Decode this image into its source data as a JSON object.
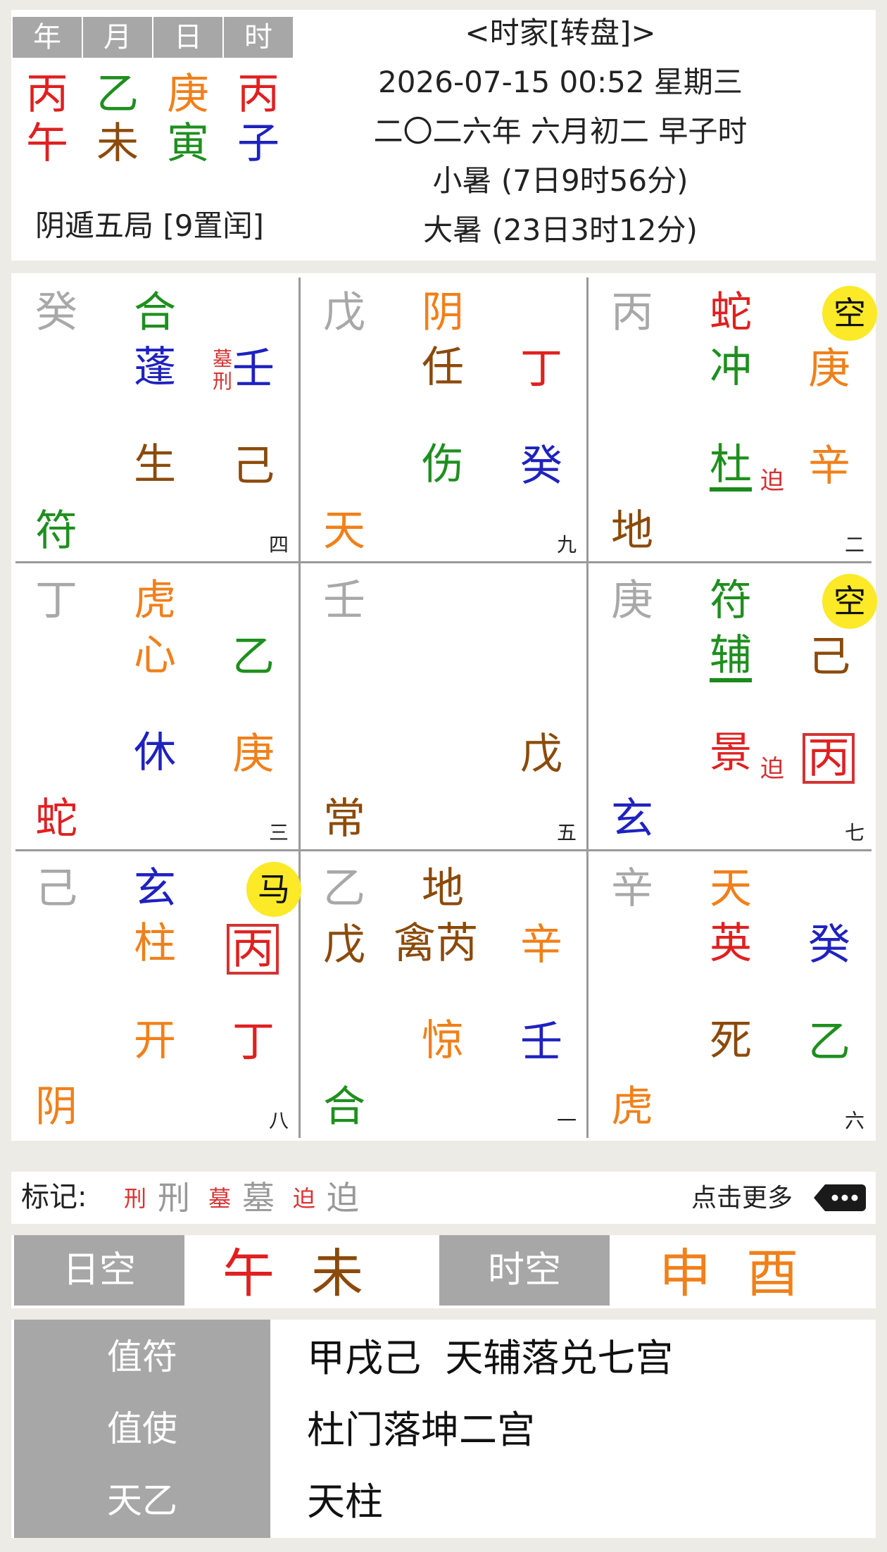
{
  "header": {
    "pillar_labels": [
      "年",
      "月",
      "日",
      "时"
    ],
    "stems": [
      "丙",
      "乙",
      "庚",
      "丙"
    ],
    "branches": [
      "午",
      "未",
      "寅",
      "子"
    ],
    "stem_colors": [
      "#e02020",
      "#1e8f1e",
      "#f0801a",
      "#e02020"
    ],
    "branch_colors": [
      "#e02020",
      "#8b4a0a",
      "#1e8f1e",
      "#1e22c0"
    ],
    "ju": "阴遁五局 [9置闰]",
    "title": "<时家[转盘]>",
    "datetime": "2026-07-15 00:52 星期三",
    "lunar": "二〇二六年 六月初二 早子时",
    "term1": "小暑 (7日9时56分)",
    "term2": "大暑 (23日3时12分)"
  },
  "palaces": [
    {
      "earth": "癸",
      "god": {
        "t": "合",
        "c": "#1e8f1e"
      },
      "star": {
        "t": "蓬",
        "c": "#1e22c0"
      },
      "ts": {
        "t": "壬",
        "c": "#1e22c0"
      },
      "door": {
        "t": "生",
        "c": "#8b4a0a"
      },
      "ds": {
        "t": "己",
        "c": "#8b4a0a"
      },
      "corner": {
        "t": "符",
        "c": "#1e8f1e"
      },
      "num": "四",
      "marks": [
        "墓",
        "刑"
      ]
    },
    {
      "earth": "戊",
      "god": {
        "t": "阴",
        "c": "#f0801a"
      },
      "star": {
        "t": "任",
        "c": "#8b4a0a"
      },
      "ts": {
        "t": "丁",
        "c": "#e02020"
      },
      "door": {
        "t": "伤",
        "c": "#1e8f1e"
      },
      "ds": {
        "t": "癸",
        "c": "#1e22c0"
      },
      "corner": {
        "t": "天",
        "c": "#f0801a"
      },
      "num": "九"
    },
    {
      "earth": "丙",
      "god": {
        "t": "蛇",
        "c": "#e02020"
      },
      "star": {
        "t": "冲",
        "c": "#1e8f1e"
      },
      "ts": {
        "t": "庚",
        "c": "#f0801a"
      },
      "door": {
        "t": "杜",
        "c": "#1e8f1e"
      },
      "ds": {
        "t": "辛",
        "c": "#f0801a"
      },
      "corner": {
        "t": "地",
        "c": "#8b4a0a"
      },
      "num": "二",
      "kong": "空",
      "door_mark": "迫"
    },
    {
      "earth": "丁",
      "god": {
        "t": "虎",
        "c": "#f0801a"
      },
      "star": {
        "t": "心",
        "c": "#f0801a"
      },
      "ts": {
        "t": "乙",
        "c": "#1e8f1e"
      },
      "door": {
        "t": "休",
        "c": "#1e22c0"
      },
      "ds": {
        "t": "庚",
        "c": "#f0801a"
      },
      "corner": {
        "t": "蛇",
        "c": "#e02020"
      },
      "num": "三"
    },
    {
      "earth": "壬",
      "ds": {
        "t": "戊",
        "c": "#8b4a0a"
      },
      "corner": {
        "t": "常",
        "c": "#8b4a0a"
      },
      "num": "五"
    },
    {
      "earth": "庚",
      "god": {
        "t": "符",
        "c": "#1e8f1e"
      },
      "star": {
        "t": "辅",
        "c": "#1e8f1e"
      },
      "ts": {
        "t": "己",
        "c": "#8b4a0a"
      },
      "door": {
        "t": "景",
        "c": "#e02020"
      },
      "ds": {
        "t": "丙",
        "c": "#e02020"
      },
      "corner": {
        "t": "玄",
        "c": "#1e22c0"
      },
      "num": "七",
      "kong": "空",
      "door_mark": "迫"
    },
    {
      "earth": "己",
      "god": {
        "t": "玄",
        "c": "#1e22c0"
      },
      "star": {
        "t": "柱",
        "c": "#f0801a"
      },
      "ts": {
        "t": "丙",
        "c": "#e02020"
      },
      "door": {
        "t": "开",
        "c": "#f0801a"
      },
      "ds": {
        "t": "丁",
        "c": "#e02020"
      },
      "corner": {
        "t": "阴",
        "c": "#f0801a"
      },
      "num": "八",
      "kong": "马"
    },
    {
      "earth": "乙",
      "god": {
        "t": "地",
        "c": "#8b4a0a"
      },
      "star": {
        "t": "禽芮",
        "c": "#8b4a0a"
      },
      "ts": {
        "t": "辛",
        "c": "#f0801a"
      },
      "left": {
        "t": "戊",
        "c": "#8b4a0a"
      },
      "door": {
        "t": "惊",
        "c": "#f0801a"
      },
      "ds": {
        "t": "壬",
        "c": "#1e22c0"
      },
      "corner": {
        "t": "合",
        "c": "#1e8f1e"
      },
      "num": "一"
    },
    {
      "earth": "辛",
      "god": {
        "t": "天",
        "c": "#f0801a"
      },
      "star": {
        "t": "英",
        "c": "#e02020"
      },
      "ts": {
        "t": "癸",
        "c": "#1e22c0"
      },
      "door": {
        "t": "死",
        "c": "#8b4a0a"
      },
      "ds": {
        "t": "乙",
        "c": "#1e8f1e"
      },
      "corner": {
        "t": "虎",
        "c": "#f0801a"
      },
      "num": "六"
    }
  ],
  "legend": {
    "label": "标记:",
    "items": [
      {
        "small": "刑",
        "big": "刑"
      },
      {
        "small": "墓",
        "big": "墓"
      },
      {
        "small": "迫",
        "big": "迫"
      }
    ],
    "more": "点击更多"
  },
  "kong": {
    "day_label": "日空",
    "day_values": [
      "午",
      "未"
    ],
    "hour_label": "时空",
    "hour_values": [
      "申",
      "酉"
    ]
  },
  "bottom": {
    "rows": [
      {
        "label": "值符",
        "value": "甲戌己  天辅落兑七宫"
      },
      {
        "label": "值使",
        "value": "杜门落坤二宫"
      },
      {
        "label": "天乙",
        "value": "天柱"
      }
    ]
  },
  "colors": {
    "gray_box": "#a7a7a7",
    "earth_text": "#a8a8a8",
    "kong_circle": "#fce928",
    "mark_red": "#d33333"
  }
}
